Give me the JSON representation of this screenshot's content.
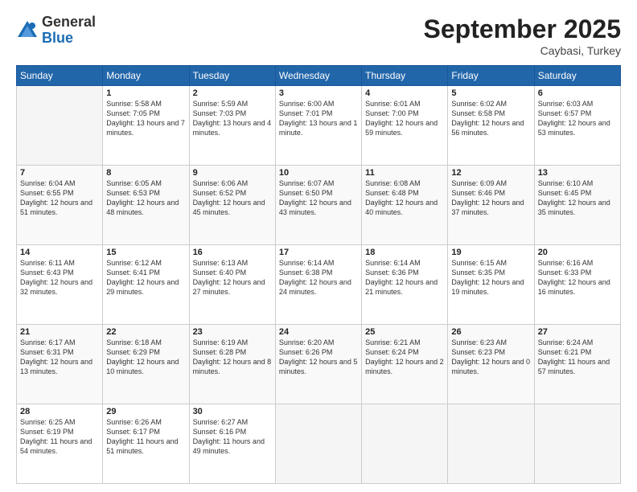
{
  "logo": {
    "general": "General",
    "blue": "Blue"
  },
  "header": {
    "month": "September 2025",
    "location": "Caybasi, Turkey"
  },
  "days": [
    "Sunday",
    "Monday",
    "Tuesday",
    "Wednesday",
    "Thursday",
    "Friday",
    "Saturday"
  ],
  "weeks": [
    [
      {
        "day": "",
        "sunrise": "",
        "sunset": "",
        "daylight": ""
      },
      {
        "day": "1",
        "sunrise": "Sunrise: 5:58 AM",
        "sunset": "Sunset: 7:05 PM",
        "daylight": "Daylight: 13 hours and 7 minutes."
      },
      {
        "day": "2",
        "sunrise": "Sunrise: 5:59 AM",
        "sunset": "Sunset: 7:03 PM",
        "daylight": "Daylight: 13 hours and 4 minutes."
      },
      {
        "day": "3",
        "sunrise": "Sunrise: 6:00 AM",
        "sunset": "Sunset: 7:01 PM",
        "daylight": "Daylight: 13 hours and 1 minute."
      },
      {
        "day": "4",
        "sunrise": "Sunrise: 6:01 AM",
        "sunset": "Sunset: 7:00 PM",
        "daylight": "Daylight: 12 hours and 59 minutes."
      },
      {
        "day": "5",
        "sunrise": "Sunrise: 6:02 AM",
        "sunset": "Sunset: 6:58 PM",
        "daylight": "Daylight: 12 hours and 56 minutes."
      },
      {
        "day": "6",
        "sunrise": "Sunrise: 6:03 AM",
        "sunset": "Sunset: 6:57 PM",
        "daylight": "Daylight: 12 hours and 53 minutes."
      }
    ],
    [
      {
        "day": "7",
        "sunrise": "Sunrise: 6:04 AM",
        "sunset": "Sunset: 6:55 PM",
        "daylight": "Daylight: 12 hours and 51 minutes."
      },
      {
        "day": "8",
        "sunrise": "Sunrise: 6:05 AM",
        "sunset": "Sunset: 6:53 PM",
        "daylight": "Daylight: 12 hours and 48 minutes."
      },
      {
        "day": "9",
        "sunrise": "Sunrise: 6:06 AM",
        "sunset": "Sunset: 6:52 PM",
        "daylight": "Daylight: 12 hours and 45 minutes."
      },
      {
        "day": "10",
        "sunrise": "Sunrise: 6:07 AM",
        "sunset": "Sunset: 6:50 PM",
        "daylight": "Daylight: 12 hours and 43 minutes."
      },
      {
        "day": "11",
        "sunrise": "Sunrise: 6:08 AM",
        "sunset": "Sunset: 6:48 PM",
        "daylight": "Daylight: 12 hours and 40 minutes."
      },
      {
        "day": "12",
        "sunrise": "Sunrise: 6:09 AM",
        "sunset": "Sunset: 6:46 PM",
        "daylight": "Daylight: 12 hours and 37 minutes."
      },
      {
        "day": "13",
        "sunrise": "Sunrise: 6:10 AM",
        "sunset": "Sunset: 6:45 PM",
        "daylight": "Daylight: 12 hours and 35 minutes."
      }
    ],
    [
      {
        "day": "14",
        "sunrise": "Sunrise: 6:11 AM",
        "sunset": "Sunset: 6:43 PM",
        "daylight": "Daylight: 12 hours and 32 minutes."
      },
      {
        "day": "15",
        "sunrise": "Sunrise: 6:12 AM",
        "sunset": "Sunset: 6:41 PM",
        "daylight": "Daylight: 12 hours and 29 minutes."
      },
      {
        "day": "16",
        "sunrise": "Sunrise: 6:13 AM",
        "sunset": "Sunset: 6:40 PM",
        "daylight": "Daylight: 12 hours and 27 minutes."
      },
      {
        "day": "17",
        "sunrise": "Sunrise: 6:14 AM",
        "sunset": "Sunset: 6:38 PM",
        "daylight": "Daylight: 12 hours and 24 minutes."
      },
      {
        "day": "18",
        "sunrise": "Sunrise: 6:14 AM",
        "sunset": "Sunset: 6:36 PM",
        "daylight": "Daylight: 12 hours and 21 minutes."
      },
      {
        "day": "19",
        "sunrise": "Sunrise: 6:15 AM",
        "sunset": "Sunset: 6:35 PM",
        "daylight": "Daylight: 12 hours and 19 minutes."
      },
      {
        "day": "20",
        "sunrise": "Sunrise: 6:16 AM",
        "sunset": "Sunset: 6:33 PM",
        "daylight": "Daylight: 12 hours and 16 minutes."
      }
    ],
    [
      {
        "day": "21",
        "sunrise": "Sunrise: 6:17 AM",
        "sunset": "Sunset: 6:31 PM",
        "daylight": "Daylight: 12 hours and 13 minutes."
      },
      {
        "day": "22",
        "sunrise": "Sunrise: 6:18 AM",
        "sunset": "Sunset: 6:29 PM",
        "daylight": "Daylight: 12 hours and 10 minutes."
      },
      {
        "day": "23",
        "sunrise": "Sunrise: 6:19 AM",
        "sunset": "Sunset: 6:28 PM",
        "daylight": "Daylight: 12 hours and 8 minutes."
      },
      {
        "day": "24",
        "sunrise": "Sunrise: 6:20 AM",
        "sunset": "Sunset: 6:26 PM",
        "daylight": "Daylight: 12 hours and 5 minutes."
      },
      {
        "day": "25",
        "sunrise": "Sunrise: 6:21 AM",
        "sunset": "Sunset: 6:24 PM",
        "daylight": "Daylight: 12 hours and 2 minutes."
      },
      {
        "day": "26",
        "sunrise": "Sunrise: 6:23 AM",
        "sunset": "Sunset: 6:23 PM",
        "daylight": "Daylight: 12 hours and 0 minutes."
      },
      {
        "day": "27",
        "sunrise": "Sunrise: 6:24 AM",
        "sunset": "Sunset: 6:21 PM",
        "daylight": "Daylight: 11 hours and 57 minutes."
      }
    ],
    [
      {
        "day": "28",
        "sunrise": "Sunrise: 6:25 AM",
        "sunset": "Sunset: 6:19 PM",
        "daylight": "Daylight: 11 hours and 54 minutes."
      },
      {
        "day": "29",
        "sunrise": "Sunrise: 6:26 AM",
        "sunset": "Sunset: 6:17 PM",
        "daylight": "Daylight: 11 hours and 51 minutes."
      },
      {
        "day": "30",
        "sunrise": "Sunrise: 6:27 AM",
        "sunset": "Sunset: 6:16 PM",
        "daylight": "Daylight: 11 hours and 49 minutes."
      },
      {
        "day": "",
        "sunrise": "",
        "sunset": "",
        "daylight": ""
      },
      {
        "day": "",
        "sunrise": "",
        "sunset": "",
        "daylight": ""
      },
      {
        "day": "",
        "sunrise": "",
        "sunset": "",
        "daylight": ""
      },
      {
        "day": "",
        "sunrise": "",
        "sunset": "",
        "daylight": ""
      }
    ]
  ]
}
